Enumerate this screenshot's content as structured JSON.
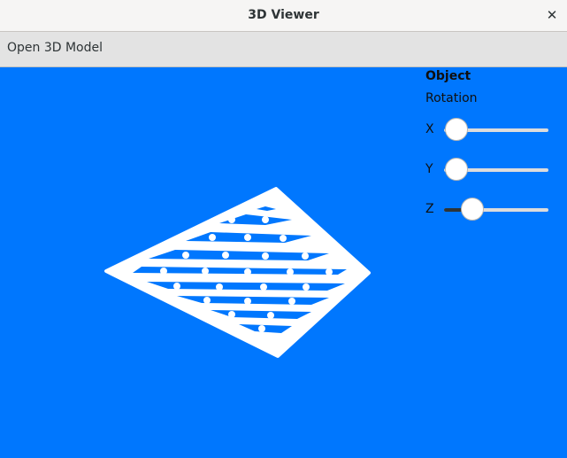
{
  "window": {
    "title": "3D Viewer",
    "close_glyph": "✕"
  },
  "toolbar": {
    "open_label": "Open 3D Model"
  },
  "panel": {
    "object_label": "Object",
    "rotation_label": "Rotation",
    "sliders": [
      {
        "axis": "X",
        "value": 0.0
      },
      {
        "axis": "Y",
        "value": 0.0
      },
      {
        "axis": "Z",
        "value": 0.2
      }
    ]
  },
  "viewport": {
    "background": "#0077fe",
    "model_color": "#ffffff"
  }
}
